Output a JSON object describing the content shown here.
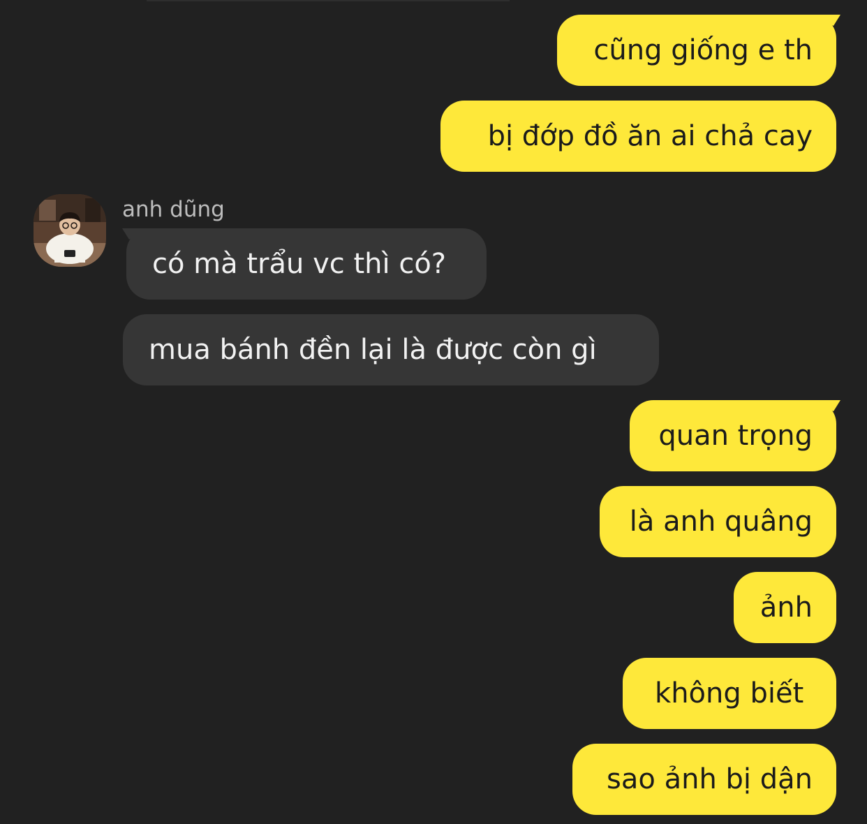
{
  "colors": {
    "background": "#212121",
    "outgoing_bubble": "#FEE83A",
    "incoming_bubble": "#363636",
    "outgoing_text": "#1b1b1b",
    "incoming_text": "#f2f2f2",
    "sender_name": "#bdbdbd"
  },
  "sender": {
    "name": "anh dũng",
    "avatar": "profile-photo"
  },
  "messages": [
    {
      "direction": "out",
      "text": "cũng giống e th"
    },
    {
      "direction": "out",
      "text": "bị đớp đồ ăn ai chả cay"
    },
    {
      "direction": "in",
      "text": "có mà trẩu vc thì có?"
    },
    {
      "direction": "in",
      "text": "mua bánh đền lại là được còn gì"
    },
    {
      "direction": "out",
      "text": "quan trọng"
    },
    {
      "direction": "out",
      "text": "là anh quâng"
    },
    {
      "direction": "out",
      "text": "ảnh"
    },
    {
      "direction": "out",
      "text": "không biết "
    },
    {
      "direction": "out",
      "text": "sao ảnh bị dận"
    }
  ]
}
